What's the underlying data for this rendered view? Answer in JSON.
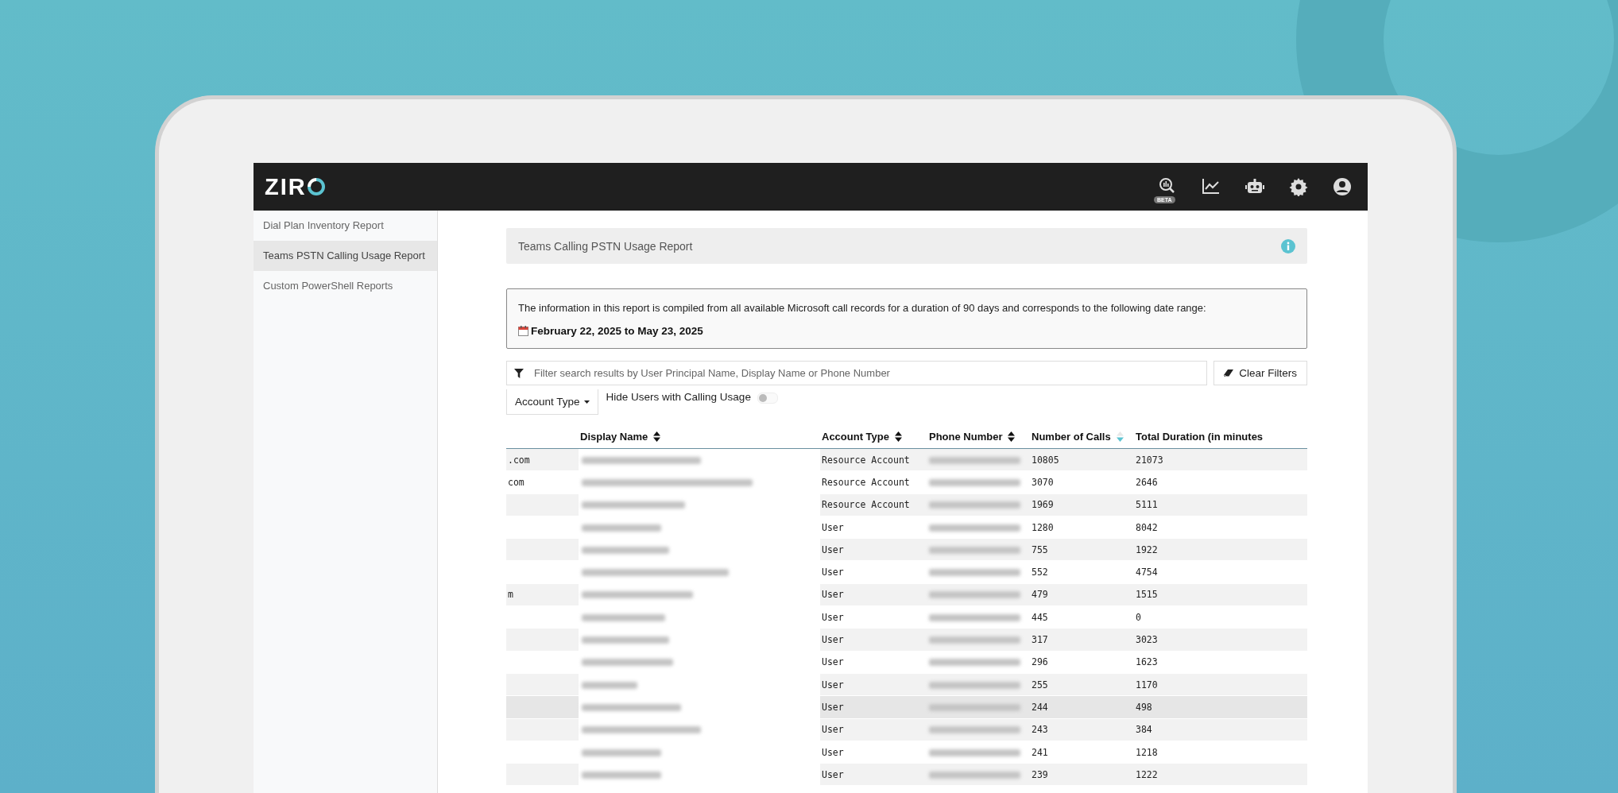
{
  "logo": {
    "text": "ZIR"
  },
  "header_icons": [
    {
      "kind": "insights",
      "badge": "BETA"
    },
    {
      "kind": "chart"
    },
    {
      "kind": "robot"
    },
    {
      "kind": "settings"
    },
    {
      "kind": "account"
    }
  ],
  "sidebar": {
    "items": [
      {
        "label": "Dial Plan Inventory Report",
        "selected": false
      },
      {
        "label": "Teams PSTN Calling Usage Report",
        "selected": true
      },
      {
        "label": "Custom PowerShell Reports",
        "selected": false
      }
    ]
  },
  "report_title": "Teams Calling PSTN Usage Report",
  "info": {
    "text": "The information in this report is compiled from all available Microsoft call records for a duration of 90 days and corresponds to the following date range:",
    "date_range": "February 22, 2025 to May 23, 2025"
  },
  "filter": {
    "placeholder": "Filter search results by User Principal Name, Display Name or Phone Number",
    "clear_button": "Clear Filters"
  },
  "account_type_dropdown": "Account Type",
  "toggle": {
    "label": "Hide Users with Calling Usage",
    "on": false
  },
  "table": {
    "columns": [
      {
        "kind": "text"
      },
      {
        "kind": "redacted",
        "label": "Display Name",
        "sorted_desc": false
      },
      {
        "kind": "text",
        "label": "Account Type",
        "sorted_desc": false
      },
      {
        "kind": "redacted",
        "label": "Phone Number",
        "sorted_desc": false
      },
      {
        "kind": "text",
        "label": "Number of Calls",
        "sorted_desc": true
      },
      {
        "kind": "text",
        "label": "Total Duration (in minutes"
      }
    ],
    "rows": [
      {
        "cells": [
          ".com",
          null,
          "Resource Account",
          null,
          "10805",
          "21073"
        ],
        "hovered": false
      },
      {
        "cells": [
          "com",
          null,
          "Resource Account",
          null,
          "3070",
          "2646"
        ],
        "hovered": false
      },
      {
        "cells": [
          null,
          null,
          "Resource Account",
          null,
          "1969",
          "5111"
        ],
        "hovered": false
      },
      {
        "cells": [
          null,
          null,
          "User",
          null,
          "1280",
          "8042"
        ],
        "hovered": false
      },
      {
        "cells": [
          null,
          null,
          "User",
          null,
          "755",
          "1922"
        ],
        "hovered": false
      },
      {
        "cells": [
          null,
          null,
          "User",
          null,
          "552",
          "4754"
        ],
        "hovered": false
      },
      {
        "cells": [
          "m",
          null,
          "User",
          null,
          "479",
          "1515"
        ],
        "hovered": false
      },
      {
        "cells": [
          null,
          null,
          "User",
          null,
          "445",
          "0"
        ],
        "hovered": false
      },
      {
        "cells": [
          null,
          null,
          "User",
          null,
          "317",
          "3023"
        ],
        "hovered": false
      },
      {
        "cells": [
          null,
          null,
          "User",
          null,
          "296",
          "1623"
        ],
        "hovered": false
      },
      {
        "cells": [
          null,
          null,
          "User",
          null,
          "255",
          "1170"
        ],
        "hovered": false
      },
      {
        "cells": [
          null,
          null,
          "User",
          null,
          "244",
          "498"
        ],
        "hovered": true
      },
      {
        "cells": [
          null,
          null,
          "User",
          null,
          "243",
          "384"
        ],
        "hovered": false
      },
      {
        "cells": [
          null,
          null,
          "User",
          null,
          "241",
          "1218"
        ],
        "hovered": false
      },
      {
        "cells": [
          null,
          null,
          "User",
          null,
          "239",
          "1222"
        ],
        "hovered": false
      }
    ]
  }
}
